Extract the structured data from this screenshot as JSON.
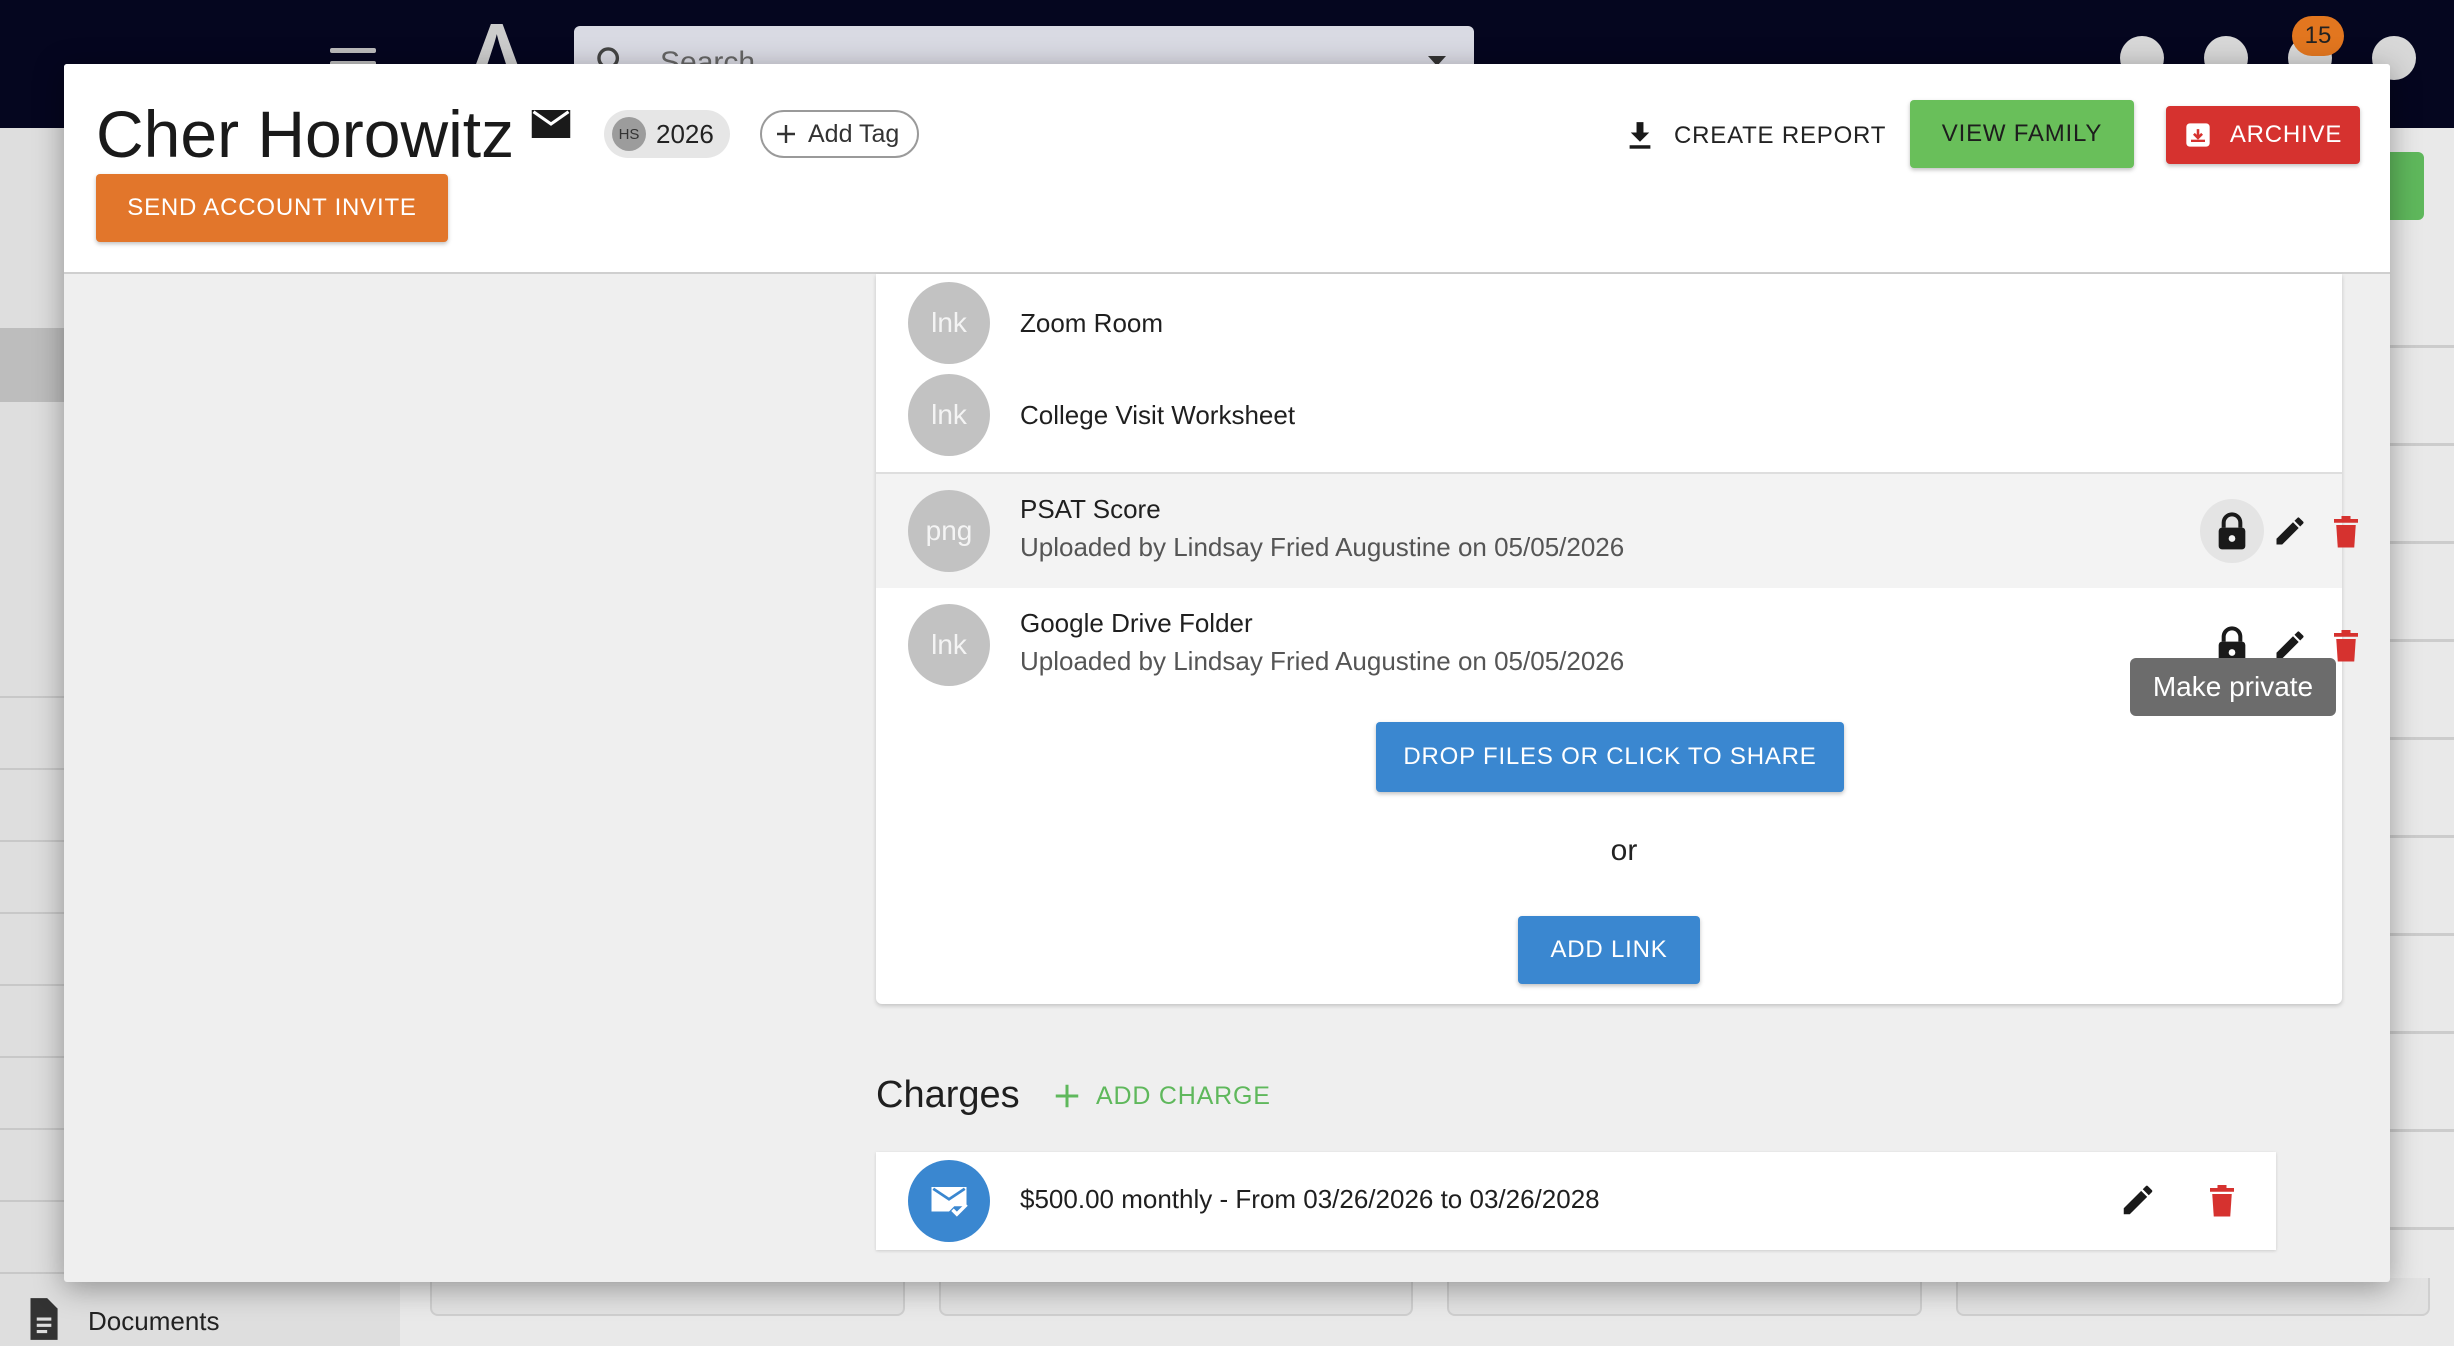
{
  "background": {
    "search_placeholder": "Search",
    "notification_count": "15",
    "sidebar_label": "Documents"
  },
  "header": {
    "student_name": "Cher Horowitz",
    "grad_chip": {
      "avatar": "HS",
      "year": "2026"
    },
    "add_tag_label": "Add Tag",
    "create_report_label": "CREATE REPORT",
    "view_family_label": "VIEW FAMILY",
    "archive_label": "ARCHIVE",
    "send_invite_label": "SEND ACCOUNT INVITE"
  },
  "documents": {
    "items": [
      {
        "type": "lnk",
        "title": "Zoom Room",
        "subtitle": ""
      },
      {
        "type": "lnk",
        "title": "College Visit Worksheet",
        "subtitle": ""
      },
      {
        "type": "png",
        "title": "PSAT Score",
        "subtitle": "Uploaded by Lindsay Fried Augustine on 05/05/2026"
      },
      {
        "type": "lnk",
        "title": "Google Drive Folder",
        "subtitle": "Uploaded by Lindsay Fried Augustine on 05/05/2026"
      }
    ],
    "tooltip": "Make private",
    "drop_button_label": "DROP FILES OR CLICK TO SHARE",
    "or_label": "or",
    "add_link_label": "ADD LINK"
  },
  "charges": {
    "title": "Charges",
    "add_charge_label": "ADD CHARGE",
    "items": [
      {
        "text": "$500.00 monthly - From 03/26/2026 to 03/26/2028"
      }
    ]
  },
  "colors": {
    "accent_blue": "#3a87d0",
    "view_family_green": "#69bf5a",
    "archive_red": "#d6322f",
    "invite_orange": "#e2762b",
    "delete_red": "#d6322f"
  }
}
